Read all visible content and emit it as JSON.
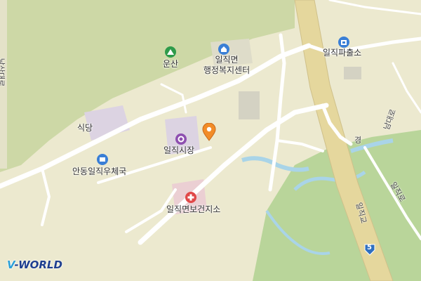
{
  "map": {
    "labels": {
      "unsan": "운산",
      "admin_center_line1": "일직면",
      "admin_center_line2": "행정복지센터",
      "police": "일직파출소",
      "restaurant": "식당",
      "market": "일직시장",
      "post_office": "안동일직우체국",
      "health_center": "일직면보건지소",
      "road_vertical_left": "남산대로",
      "road_upper_right": "남대로",
      "road_right": "일직로",
      "road_bridge": "일직교",
      "road_short": "경",
      "route_number": "5"
    },
    "icons": {
      "mountain": "mountain-icon",
      "admin": "government-office-icon",
      "police": "police-icon",
      "market": "market-icon",
      "post": "post-office-icon",
      "health": "hospital-icon",
      "marker": "location-marker-icon",
      "route": "route-shield-icon"
    },
    "colors": {
      "land": "#ece9cf",
      "forest": "#cdd8a6",
      "river_green": "#b9d59a",
      "water": "#a9d4e8",
      "road": "#ffffff",
      "highway": "#e5d79d",
      "marker": "#f28c28"
    },
    "logo_text_a": "V",
    "logo_text_b": "-WORLD"
  }
}
